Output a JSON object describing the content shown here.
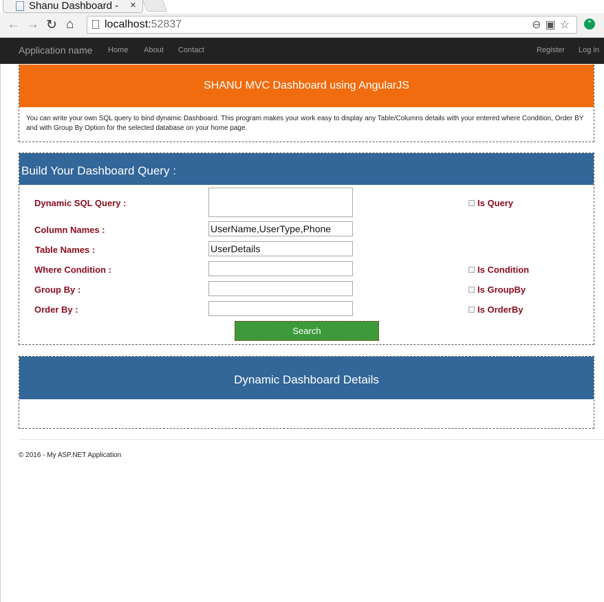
{
  "browser": {
    "tab_title": "Shanu Dashboard -",
    "tab_close": "×",
    "url_host": "localhost:",
    "url_port": "52837",
    "icons": [
      "arrow-left-icon",
      "arrow-right-icon",
      "reload-icon",
      "home-icon",
      "zoom-icon",
      "translate-icon",
      "star-icon",
      "hangouts-icon"
    ]
  },
  "navbar": {
    "brand": "Application name",
    "links": [
      "Home",
      "About",
      "Contact"
    ],
    "right_links": [
      "Register",
      "Log in"
    ]
  },
  "intro": {
    "title": "SHANU MVC Dashboard using AngularJS",
    "text": "You can write your own SQL query to bind dynamic Dashboard. This program makes your work easy to display any Table/Columns details with your entered where Condition, Order BY and with Group By Option for the selected database on your home page."
  },
  "query_form": {
    "title": "Build Your Dashboard Query :",
    "dynamic_sql_label": "Dynamic SQL Query :",
    "dynamic_sql_value": "",
    "column_names_label": "Column Names :",
    "column_names_value": "UserName,UserType,Phone",
    "table_names_label": "Table Names :",
    "table_names_value": "UserDetails",
    "where_label": "Where Condition :",
    "where_value": "",
    "groupby_label": "Group By :",
    "groupby_value": "",
    "orderby_label": "Order By :",
    "orderby_value": "",
    "is_query_label": "Is Query",
    "is_condition_label": "Is Condition",
    "is_groupby_label": "Is GroupBy",
    "is_orderby_label": "Is OrderBy",
    "search_label": "Search"
  },
  "details": {
    "title": "Dynamic Dashboard Details"
  },
  "footer": {
    "text": "© 2016 - My ASP.NET Application"
  },
  "colors": {
    "navbar": "#222222",
    "orange_banner": "#f16c0f",
    "blue_banner": "#336699",
    "label": "#8b0d1c",
    "search_button": "#3c9a3a"
  }
}
